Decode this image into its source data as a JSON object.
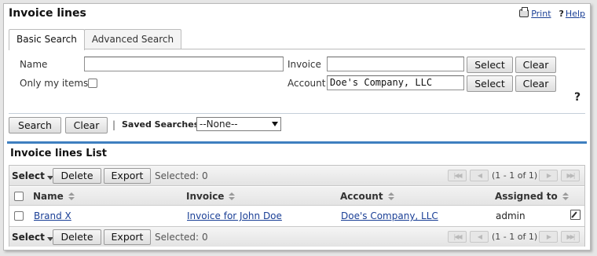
{
  "header": {
    "title": "Invoice lines",
    "print_label": "Print",
    "help_label": "Help"
  },
  "tabs": [
    {
      "label": "Basic Search",
      "active": true
    },
    {
      "label": "Advanced Search",
      "active": false
    }
  ],
  "search": {
    "name_label": "Name",
    "name_value": "",
    "only_my_items_label": "Only my items",
    "only_my_items_checked": false,
    "invoice_label": "Invoice",
    "invoice_value": "",
    "account_label": "Account",
    "account_value": "Doe's Company, LLC",
    "select_label": "Select",
    "clear_label": "Clear",
    "help_mark": "?",
    "search_button": "Search",
    "clear_button": "Clear",
    "divider": "|",
    "saved_searches_label": "Saved Searches",
    "saved_searches_value": "--None--"
  },
  "list": {
    "title": "Invoice lines List",
    "toolbar": {
      "select_label": "Select",
      "delete_label": "Delete",
      "export_label": "Export",
      "selected_label": "Selected:",
      "selected_count": "0",
      "pagination": "(1 - 1 of 1)"
    },
    "columns": [
      "Name",
      "Invoice",
      "Account",
      "Assigned to"
    ],
    "rows": [
      {
        "name": "Brand X",
        "invoice": "Invoice for John Doe",
        "account": "Doe's Company, LLC",
        "assigned_to": "admin"
      }
    ]
  },
  "colors": {
    "accent_bar": "#3e7fbf",
    "link": "#1a3f96"
  }
}
